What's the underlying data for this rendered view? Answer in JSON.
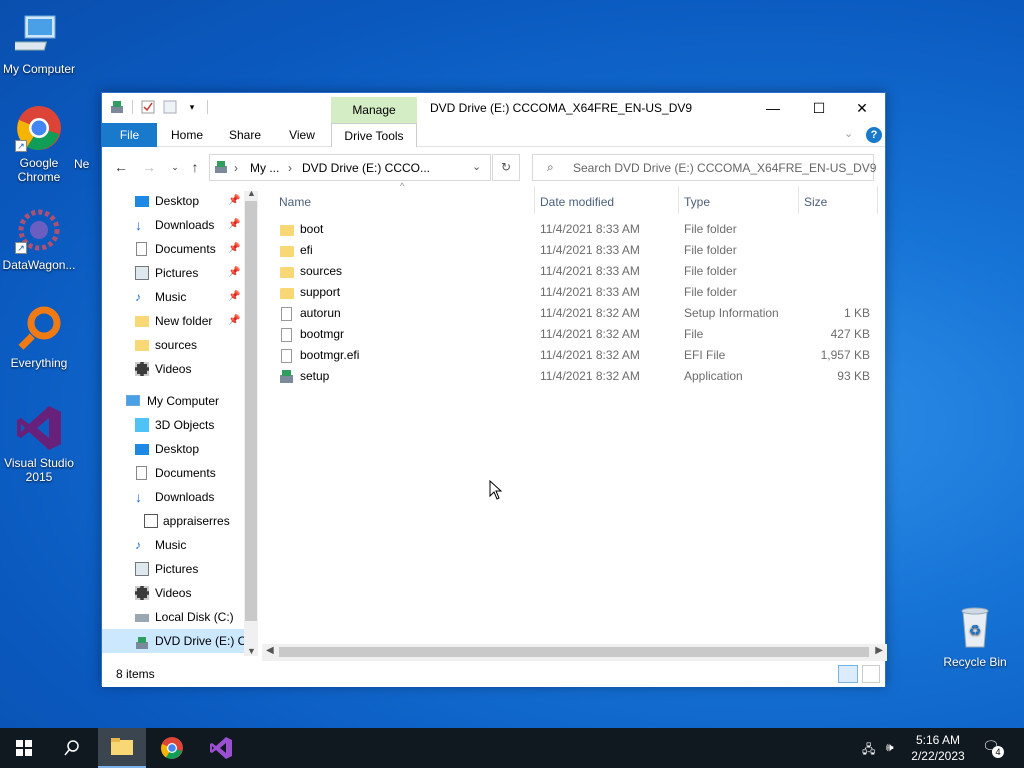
{
  "desktop": {
    "icons": [
      {
        "label": "My Computer"
      },
      {
        "label": "Google Chrome"
      },
      {
        "label": "DataWagon..."
      },
      {
        "label": "Everything"
      },
      {
        "label": "Visual Studio 2015"
      },
      {
        "label": "Recycle Bin"
      }
    ],
    "partial_label": "Ne"
  },
  "window": {
    "title": "DVD Drive (E:) CCCOMA_X64FRE_EN-US_DV9",
    "manage_tab": "Manage",
    "ribbon_tabs": [
      "File",
      "Home",
      "Share",
      "View",
      "Drive Tools"
    ],
    "breadcrumb": [
      "My ...",
      "DVD Drive (E:) CCCO..."
    ],
    "search_placeholder": "Search DVD Drive (E:) CCCOMA_X64FRE_EN-US_DV9",
    "columns": [
      "Name",
      "Date modified",
      "Type",
      "Size"
    ],
    "files": [
      {
        "name": "boot",
        "date": "11/4/2021 8:33 AM",
        "type": "File folder",
        "size": ""
      },
      {
        "name": "efi",
        "date": "11/4/2021 8:33 AM",
        "type": "File folder",
        "size": ""
      },
      {
        "name": "sources",
        "date": "11/4/2021 8:33 AM",
        "type": "File folder",
        "size": ""
      },
      {
        "name": "support",
        "date": "11/4/2021 8:33 AM",
        "type": "File folder",
        "size": ""
      },
      {
        "name": "autorun",
        "date": "11/4/2021 8:32 AM",
        "type": "Setup Information",
        "size": "1 KB"
      },
      {
        "name": "bootmgr",
        "date": "11/4/2021 8:32 AM",
        "type": "File",
        "size": "427 KB"
      },
      {
        "name": "bootmgr.efi",
        "date": "11/4/2021 8:32 AM",
        "type": "EFI File",
        "size": "1,957 KB"
      },
      {
        "name": "setup",
        "date": "11/4/2021 8:32 AM",
        "type": "Application",
        "size": "93 KB"
      }
    ],
    "nav_quick": [
      "Desktop",
      "Downloads",
      "Documents",
      "Pictures",
      "Music",
      "New folder",
      "sources",
      "Videos"
    ],
    "nav_root": "My Computer",
    "nav_pc": [
      "3D Objects",
      "Desktop",
      "Documents",
      "Downloads",
      "appraiserres",
      "Music",
      "Pictures",
      "Videos",
      "Local Disk (C:)",
      "DVD Drive (E:) CC"
    ],
    "status": "8 items"
  },
  "taskbar": {
    "time": "5:16 AM",
    "date": "2/22/2023",
    "notification_count": "4"
  },
  "colors": {
    "accent": "#1979ca",
    "manage_tab": "#d5edc4",
    "taskbar": "#101820"
  }
}
